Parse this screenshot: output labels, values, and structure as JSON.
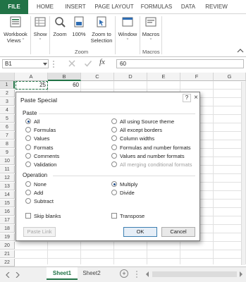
{
  "ribbon": {
    "tabs": [
      "FILE",
      "HOME",
      "INSERT",
      "PAGE LAYOUT",
      "FORMULAS",
      "DATA",
      "REVIEW"
    ],
    "buttons": {
      "workbook_views": [
        "Workbook",
        "Views ˇ"
      ],
      "show": [
        "Show",
        "ˇ"
      ],
      "zoom": "Zoom",
      "zoom100": "100%",
      "zoom_selection": [
        "Zoom to",
        "Selection"
      ],
      "window": [
        "Window",
        "ˇ"
      ],
      "macros": [
        "Macros",
        "ˇ"
      ]
    },
    "groups": {
      "zoom": "Zoom",
      "macros": "Macros"
    }
  },
  "formula_bar": {
    "name_box": "B1",
    "value": "60",
    "fx_label": "fx"
  },
  "grid": {
    "columns": [
      "A",
      "B",
      "C",
      "D",
      "E",
      "F",
      "G"
    ],
    "rows": [
      "1",
      "2",
      "3",
      "4",
      "5",
      "6",
      "7",
      "8",
      "9",
      "10",
      "11",
      "12",
      "13",
      "14",
      "15",
      "16",
      "17",
      "18",
      "19",
      "20",
      "21",
      "22"
    ],
    "cells": {
      "A1": "25",
      "B1": "60"
    }
  },
  "sheets": {
    "tabs": [
      "Sheet1",
      "Sheet2"
    ],
    "active": "Sheet1",
    "add_label": "+"
  },
  "dialog": {
    "title": "Paste Special",
    "help": "?",
    "close": "×",
    "paste_section": "Paste",
    "paste_left": [
      "All",
      "Formulas",
      "Values",
      "Formats",
      "Comments",
      "Validation"
    ],
    "paste_right": [
      "All using Source theme",
      "All except borders",
      "Column widths",
      "Formulas and number formats",
      "Values and number formats",
      "All merging conditional formats"
    ],
    "operation_section": "Operation",
    "operation_left": [
      "None",
      "Add",
      "Subtract"
    ],
    "operation_right": [
      "Multiply",
      "Divide"
    ],
    "skip_blanks": "Skip blanks",
    "transpose": "Transpose",
    "paste_link": "Paste Link",
    "ok": "OK",
    "cancel": "Cancel"
  },
  "colors": {
    "accent": "#217346",
    "selection": "#217346"
  }
}
